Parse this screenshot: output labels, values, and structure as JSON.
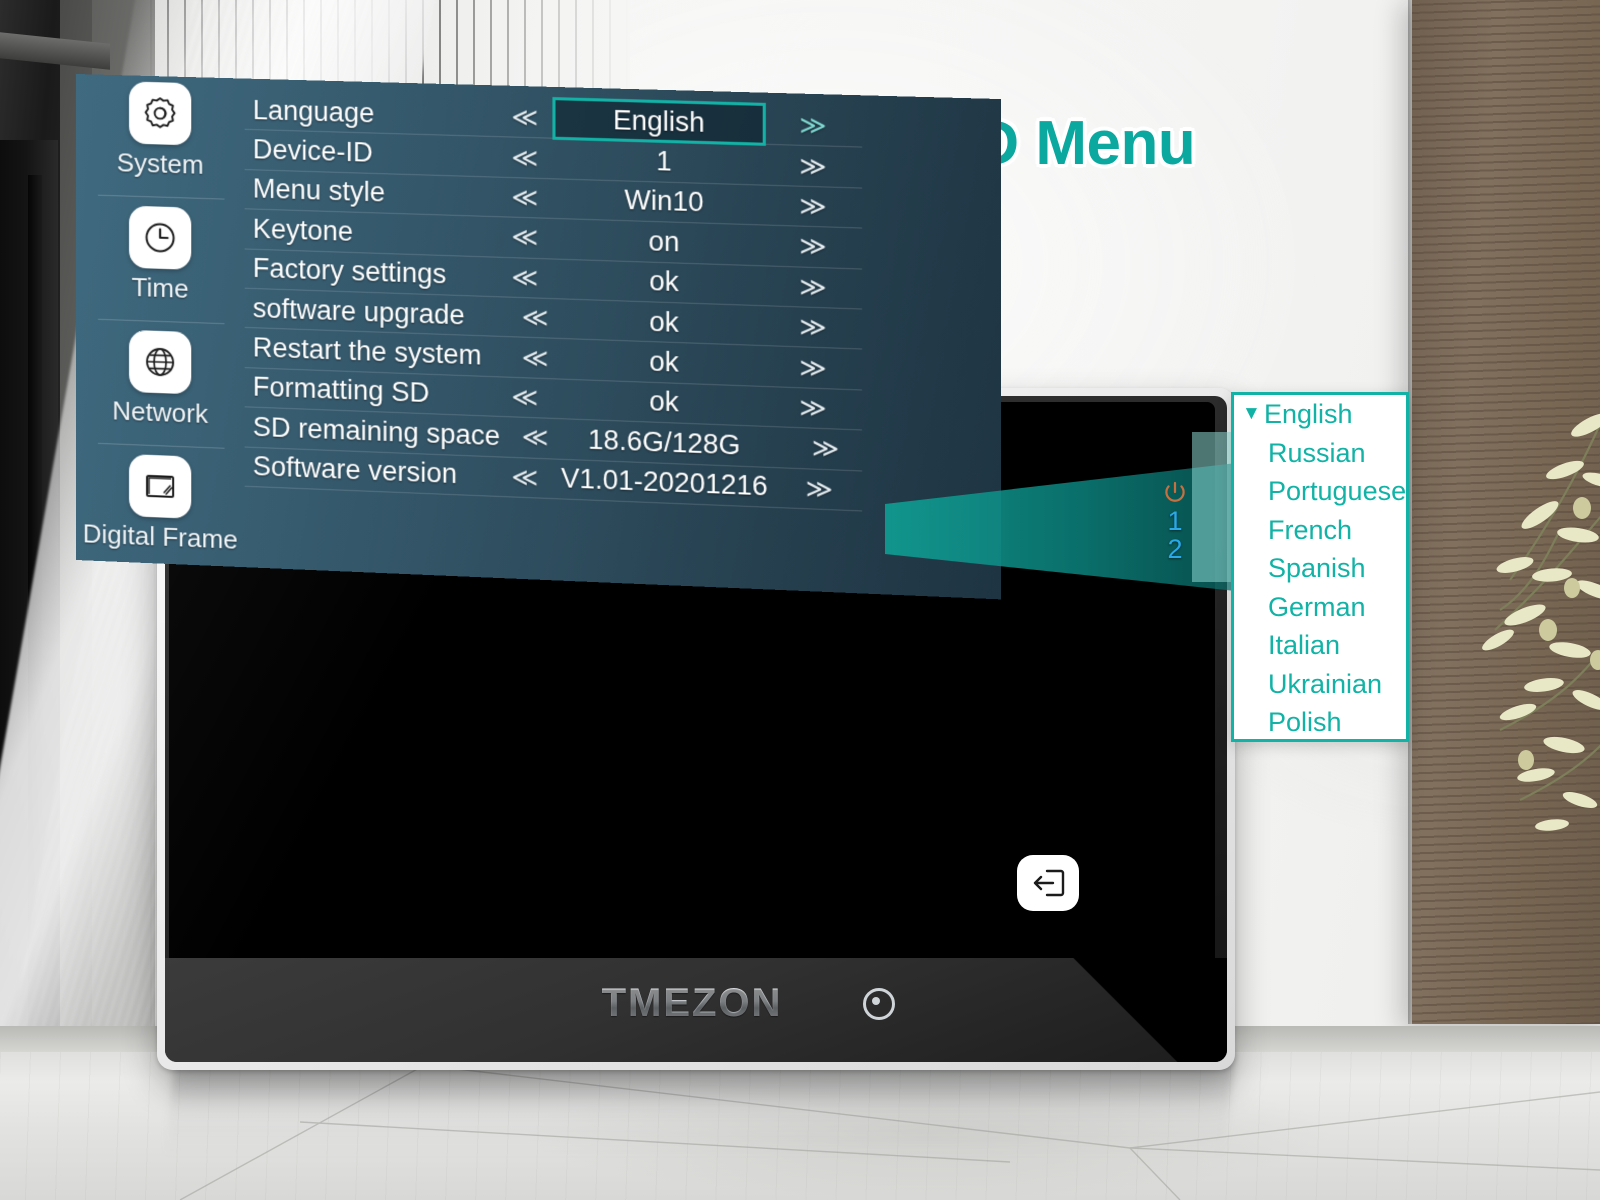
{
  "title": "Multi-languages OSD Menu",
  "brand": {
    "logo": "TMEZON"
  },
  "osd": {
    "sidebar": [
      {
        "label": "System",
        "icon": "gear-icon"
      },
      {
        "label": "Time",
        "icon": "clock-icon"
      },
      {
        "label": "Network",
        "icon": "globe-icon"
      },
      {
        "label": "Digital Frame",
        "icon": "picture-frame-icon"
      }
    ],
    "prev_arrow": "≪",
    "next_arrow": "≫",
    "rows": [
      {
        "label": "Language",
        "value": "English",
        "selected": true
      },
      {
        "label": "Device-ID",
        "value": "1",
        "selected": false
      },
      {
        "label": "Menu style",
        "value": "Win10",
        "selected": false
      },
      {
        "label": "Keytone",
        "value": "on",
        "selected": false
      },
      {
        "label": "Factory settings",
        "value": "ok",
        "selected": false
      },
      {
        "label": "software upgrade",
        "value": "ok",
        "selected": false
      },
      {
        "label": "Restart the system",
        "value": "ok",
        "selected": false
      },
      {
        "label": "Formatting SD",
        "value": "ok",
        "selected": false
      },
      {
        "label": "SD remaining space",
        "value": "18.6G/128G",
        "selected": false
      },
      {
        "label": "Software version",
        "value": "V1.01-20201216",
        "selected": false
      }
    ],
    "status": {
      "power_icon": "power-icon",
      "line1": "1",
      "line2": "2"
    },
    "exit_icon": "exit-icon"
  },
  "language_dropdown": {
    "caret": "▼",
    "items": [
      {
        "label": "English",
        "current": true
      },
      {
        "label": "Russian",
        "current": false
      },
      {
        "label": "Portuguese",
        "current": false
      },
      {
        "label": "French",
        "current": false
      },
      {
        "label": "Spanish",
        "current": false
      },
      {
        "label": "German",
        "current": false
      },
      {
        "label": "Italian",
        "current": false
      },
      {
        "label": "Ukrainian",
        "current": false
      },
      {
        "label": "Polish",
        "current": false
      }
    ]
  },
  "colors": {
    "accent_teal": "#12b3a6",
    "title_teal": "#0ba8a0",
    "osd_panel_left": "#3f6a80",
    "osd_panel_right": "#1e3442",
    "status_blue": "#2aa8e8",
    "power_orange": "#c8703f"
  }
}
